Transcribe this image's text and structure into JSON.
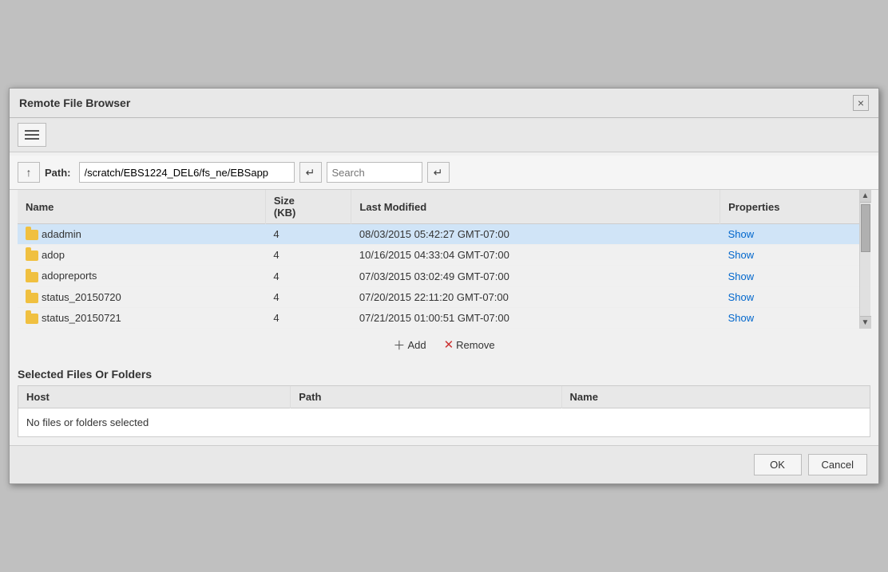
{
  "dialog": {
    "title": "Remote File Browser",
    "close_label": "×"
  },
  "toolbar": {
    "menu_label": "menu"
  },
  "pathbar": {
    "up_arrow": "↑",
    "path_label": "Path:",
    "path_value": "/scratch/EBS1224_DEL6/fs_ne/EBSapp",
    "nav_arrow": "↵",
    "search_placeholder": "Search",
    "search_arrow": "↵"
  },
  "file_table": {
    "columns": [
      "Name",
      "Size\n(KB)",
      "Last Modified",
      "Properties"
    ],
    "rows": [
      {
        "name": "adadmin",
        "size": "4",
        "modified": "08/03/2015 05:42:27 GMT-07:00",
        "properties": "Show",
        "selected": true
      },
      {
        "name": "adop",
        "size": "4",
        "modified": "10/16/2015 04:33:04 GMT-07:00",
        "properties": "Show",
        "selected": false
      },
      {
        "name": "adopreports",
        "size": "4",
        "modified": "07/03/2015 03:02:49 GMT-07:00",
        "properties": "Show",
        "selected": false
      },
      {
        "name": "status_20150720",
        "size": "4",
        "modified": "07/20/2015 22:11:20 GMT-07:00",
        "properties": "Show",
        "selected": false
      },
      {
        "name": "status_20150721",
        "size": "4",
        "modified": "07/21/2015 01:00:51 GMT-07:00",
        "properties": "Show",
        "selected": false
      }
    ]
  },
  "actions": {
    "add_label": "Add",
    "remove_label": "Remove"
  },
  "selected_section": {
    "title": "Selected Files Or Folders",
    "columns": [
      "Host",
      "Path",
      "Name"
    ],
    "no_files_text": "No files or folders selected"
  },
  "footer": {
    "ok_label": "OK",
    "cancel_label": "Cancel"
  }
}
